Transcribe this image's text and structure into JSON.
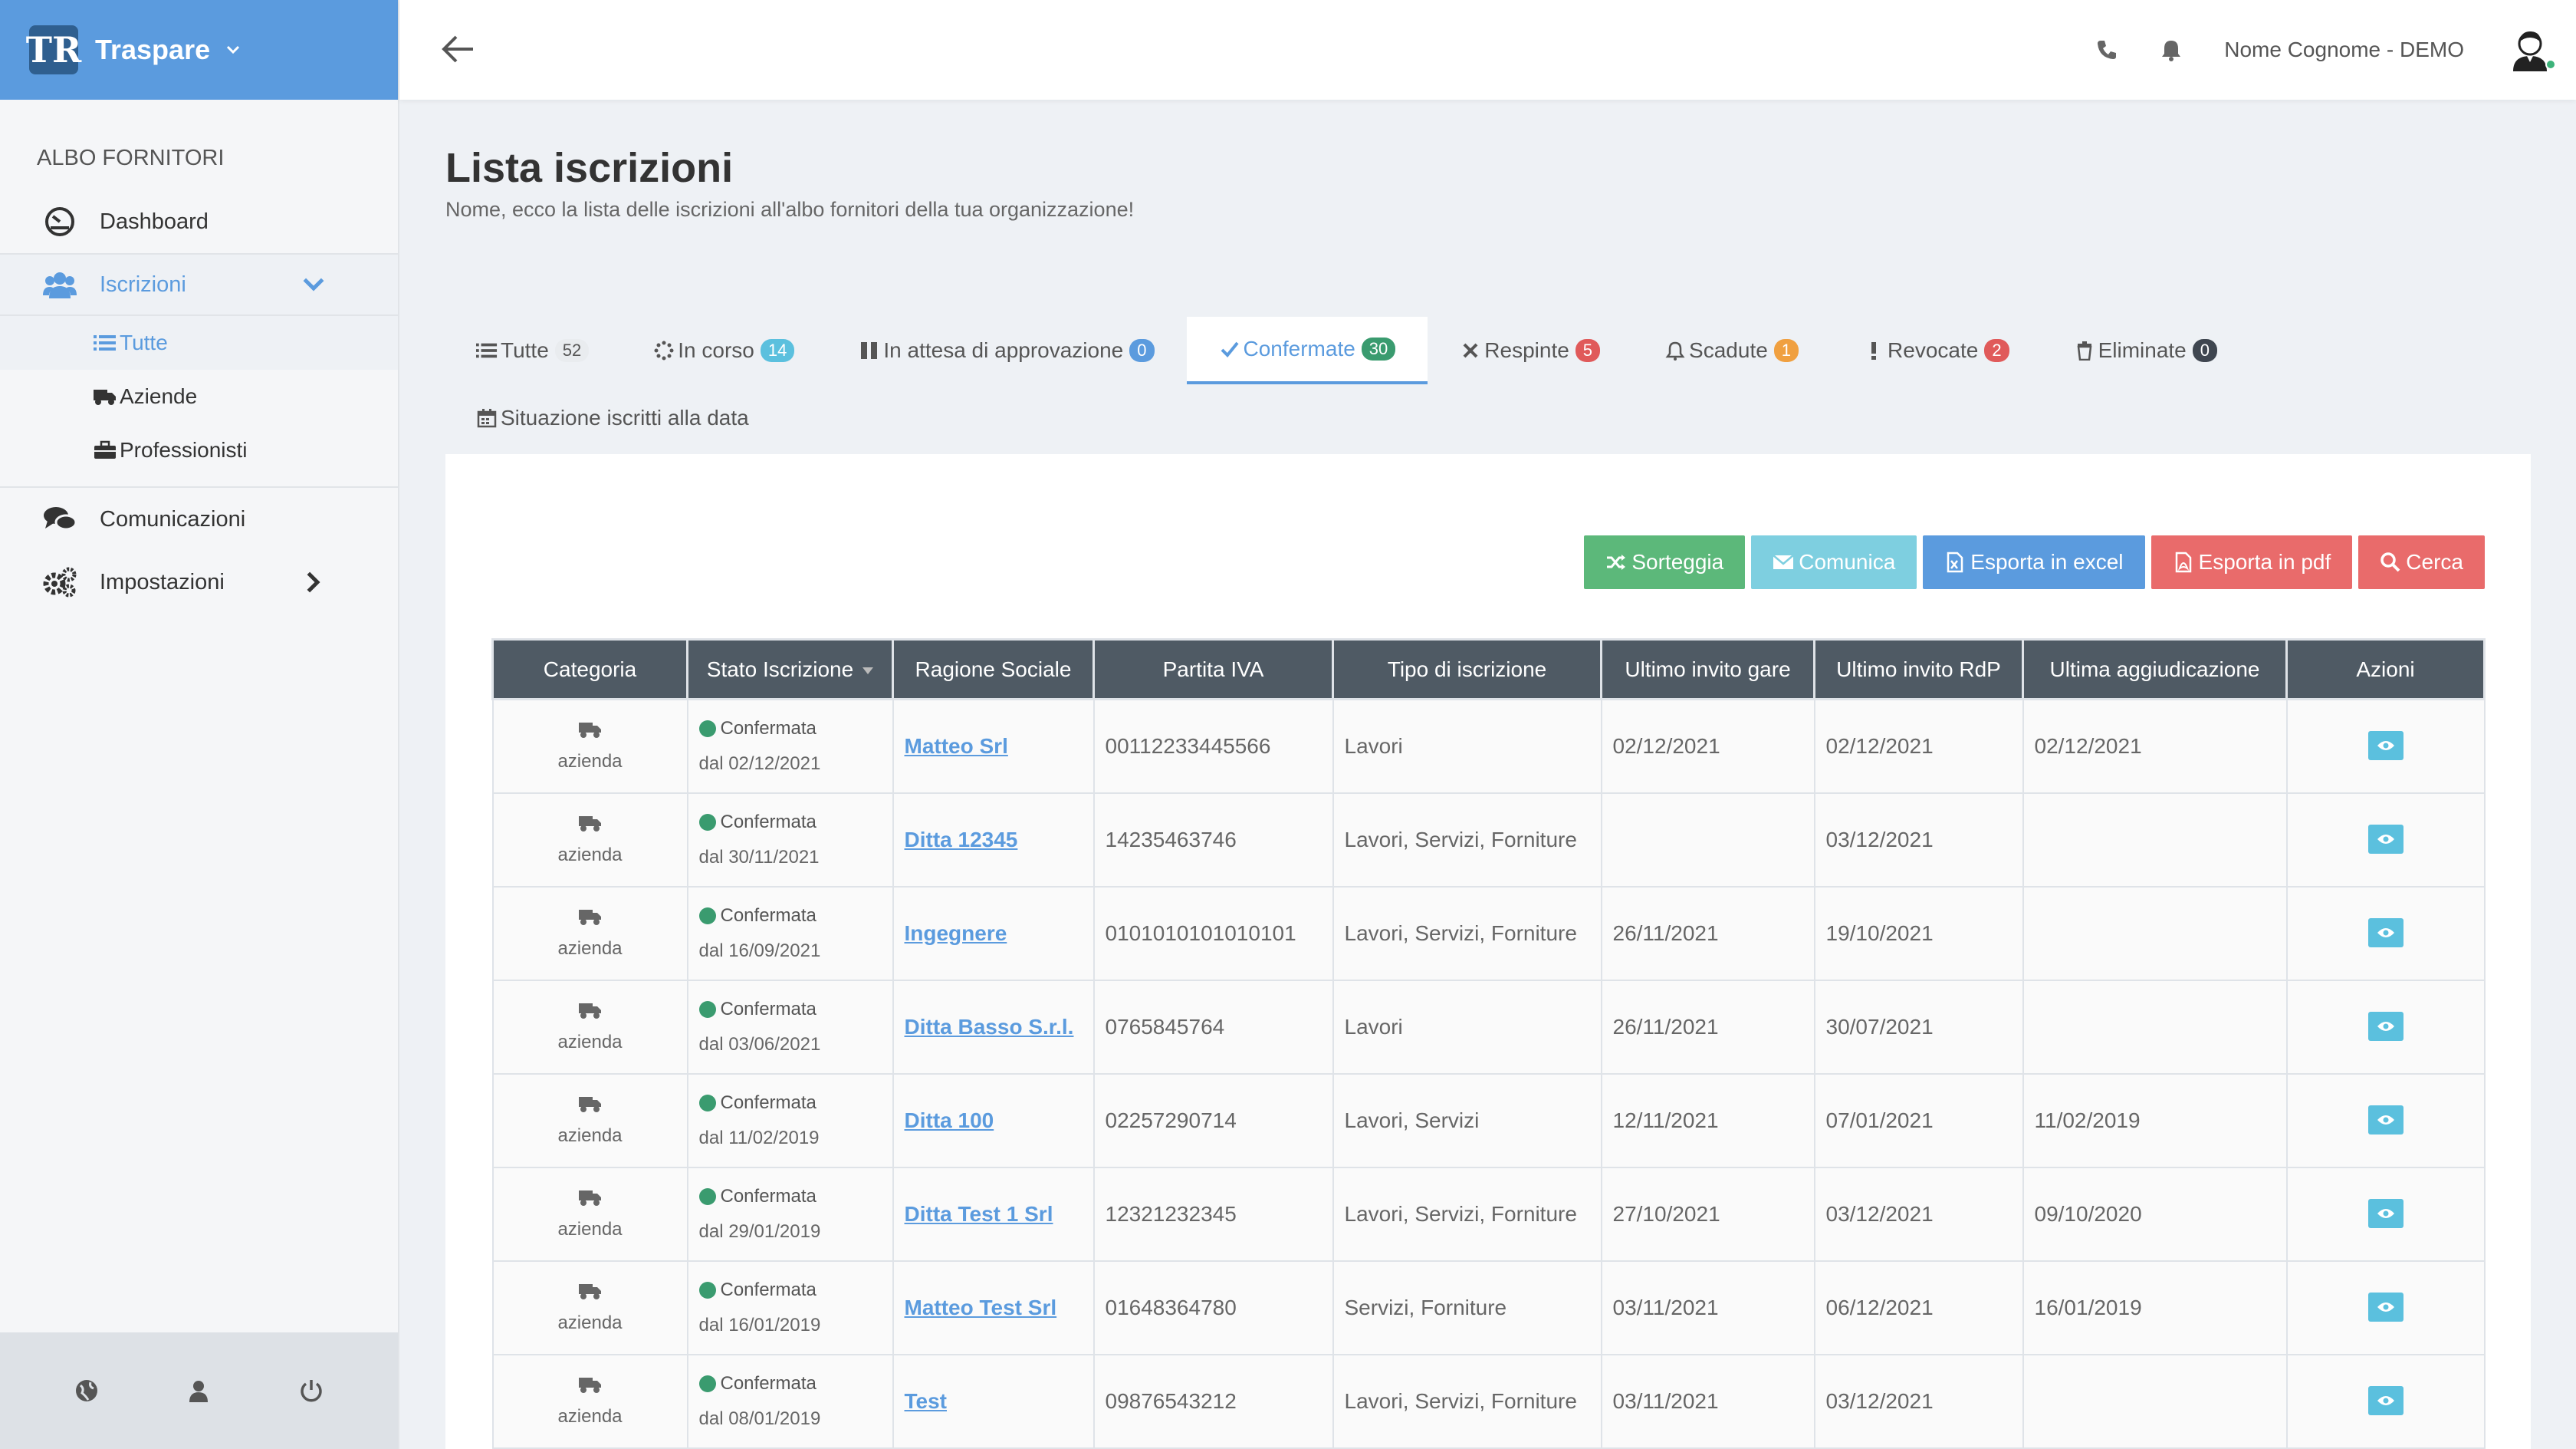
{
  "brand": {
    "name": "Traspare",
    "logo_text": "TR"
  },
  "sidebar": {
    "section": "ALBO FORNITORI",
    "items": [
      {
        "label": "Dashboard",
        "icon": "dashboard-icon"
      },
      {
        "label": "Iscrizioni",
        "icon": "users-icon"
      },
      {
        "label": "Comunicazioni",
        "icon": "comments-icon"
      },
      {
        "label": "Impostazioni",
        "icon": "cogs-icon"
      }
    ],
    "sub_items": [
      {
        "label": "Tutte",
        "icon": "list-icon"
      },
      {
        "label": "Aziende",
        "icon": "truck-icon"
      },
      {
        "label": "Professionisti",
        "icon": "briefcase-icon"
      }
    ]
  },
  "topbar": {
    "user_name": "Nome Cognome - DEMO"
  },
  "page": {
    "title": "Lista iscrizioni",
    "subtitle": "Nome, ecco la lista delle iscrizioni all'albo fornitori della tua organizzazione!"
  },
  "tabs": [
    {
      "label": "Tutte",
      "count": "52",
      "color": "#e9ecef",
      "text_color": "#555"
    },
    {
      "label": "In corso",
      "count": "14",
      "color": "#5bc0de",
      "text_color": "#fff"
    },
    {
      "label": "In attesa di approvazione",
      "count": "0",
      "color": "#5b9bde",
      "text_color": "#fff"
    },
    {
      "label": "Confermate",
      "count": "30",
      "color": "#3a9b6f",
      "text_color": "#fff"
    },
    {
      "label": "Respinte",
      "count": "5",
      "color": "#e05a5a",
      "text_color": "#fff"
    },
    {
      "label": "Scadute",
      "count": "1",
      "color": "#f0a040",
      "text_color": "#fff"
    },
    {
      "label": "Revocate",
      "count": "2",
      "color": "#e05a5a",
      "text_color": "#fff"
    },
    {
      "label": "Eliminate",
      "count": "0",
      "color": "#3f4650",
      "text_color": "#fff"
    }
  ],
  "tab_situazione": "Situazione iscritti alla data",
  "actions": [
    {
      "label": "Sorteggia",
      "color": "#5cb87a"
    },
    {
      "label": "Comunica",
      "color": "#7ecfe0"
    },
    {
      "label": "Esporta in excel",
      "color": "#5b9bde"
    },
    {
      "label": "Esporta in pdf",
      "color": "#e96b6b"
    },
    {
      "label": "Cerca",
      "color": "#e96b6b"
    }
  ],
  "table": {
    "columns": [
      "Categoria",
      "Stato Iscrizione",
      "Ragione Sociale",
      "Partita IVA",
      "Tipo di iscrizione",
      "Ultimo invito gare",
      "Ultimo invito RdP",
      "Ultima aggiudicazione",
      "Azioni"
    ],
    "rows": [
      {
        "categoria": "azienda",
        "stato": "Confermata",
        "dal": "dal 02/12/2021",
        "ragione": "Matteo Srl",
        "piva": "00112233445566",
        "tipo": "Lavori",
        "gare": "02/12/2021",
        "rdp": "02/12/2021",
        "agg": "02/12/2021"
      },
      {
        "categoria": "azienda",
        "stato": "Confermata",
        "dal": "dal 30/11/2021",
        "ragione": "Ditta 12345",
        "piva": "14235463746",
        "tipo": "Lavori, Servizi, Forniture",
        "gare": "",
        "rdp": "03/12/2021",
        "agg": ""
      },
      {
        "categoria": "azienda",
        "stato": "Confermata",
        "dal": "dal 16/09/2021",
        "ragione": "Ingegnere",
        "piva": "0101010101010101",
        "tipo": "Lavori, Servizi, Forniture",
        "gare": "26/11/2021",
        "rdp": "19/10/2021",
        "agg": ""
      },
      {
        "categoria": "azienda",
        "stato": "Confermata",
        "dal": "dal 03/06/2021",
        "ragione": "Ditta Basso S.r.l.",
        "piva": "0765845764",
        "tipo": "Lavori",
        "gare": "26/11/2021",
        "rdp": "30/07/2021",
        "agg": ""
      },
      {
        "categoria": "azienda",
        "stato": "Confermata",
        "dal": "dal 11/02/2019",
        "ragione": "Ditta 100",
        "piva": "02257290714",
        "tipo": "Lavori, Servizi",
        "gare": "12/11/2021",
        "rdp": "07/01/2021",
        "agg": "11/02/2019"
      },
      {
        "categoria": "azienda",
        "stato": "Confermata",
        "dal": "dal 29/01/2019",
        "ragione": "Ditta Test 1 Srl",
        "piva": "12321232345",
        "tipo": "Lavori, Servizi, Forniture",
        "gare": "27/10/2021",
        "rdp": "03/12/2021",
        "agg": "09/10/2020"
      },
      {
        "categoria": "azienda",
        "stato": "Confermata",
        "dal": "dal 16/01/2019",
        "ragione": "Matteo Test Srl",
        "piva": "01648364780",
        "tipo": "Servizi, Forniture",
        "gare": "03/11/2021",
        "rdp": "06/12/2021",
        "agg": "16/01/2019"
      },
      {
        "categoria": "azienda",
        "stato": "Confermata",
        "dal": "dal 08/01/2019",
        "ragione": "Test",
        "piva": "09876543212",
        "tipo": "Lavori, Servizi, Forniture",
        "gare": "03/11/2021",
        "rdp": "03/12/2021",
        "agg": ""
      }
    ]
  }
}
